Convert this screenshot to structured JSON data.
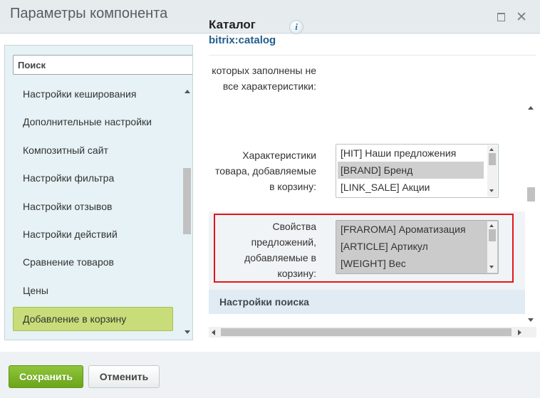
{
  "window": {
    "title": "Параметры компонента"
  },
  "sidebar": {
    "search_placeholder": "Поиск",
    "items": [
      {
        "label": "Настройки кеширования"
      },
      {
        "label": "Дополнительные настройки"
      },
      {
        "label": "Композитный сайт"
      },
      {
        "label": "Настройки фильтра"
      },
      {
        "label": "Настройки отзывов"
      },
      {
        "label": "Настройки действий"
      },
      {
        "label": "Сравнение товаров"
      },
      {
        "label": "Цены"
      },
      {
        "label": "Добавление в корзину",
        "active": true
      }
    ]
  },
  "component": {
    "name": "Каталог",
    "code": "bitrix:catalog",
    "info_icon": "info-icon"
  },
  "form": {
    "partial_label_line1": "которых заполнены не",
    "partial_label_line2": "все характеристики:",
    "product_props": {
      "label_line1": "Характеристики",
      "label_line2": "товара, добавляемые",
      "label_line3": "в корзину:",
      "options": [
        {
          "text": "[HIT] Наши предложения",
          "selected": false
        },
        {
          "text": "[BRAND] Бренд",
          "selected": true
        },
        {
          "text": "[LINK_SALE] Акции",
          "selected": false
        }
      ]
    },
    "offer_props": {
      "label_line1": "Свойства",
      "label_line2": "предложений,",
      "label_line3": "добавляемые в",
      "label_line4": "корзину:",
      "options": [
        {
          "text": "[FRAROMA] Ароматизация",
          "selected": true
        },
        {
          "text": "[ARTICLE] Артикул",
          "selected": true
        },
        {
          "text": "[WEIGHT] Вес",
          "selected": true
        }
      ]
    },
    "next_section": "Настройки поиска"
  },
  "buttons": {
    "save": "Сохранить",
    "cancel": "Отменить"
  },
  "colors": {
    "save_button": "#7ab529",
    "active_item": "#c8dd79",
    "highlight_border": "#e2161b",
    "section_header": "#e1ebf4",
    "link_code": "#235e8c"
  }
}
